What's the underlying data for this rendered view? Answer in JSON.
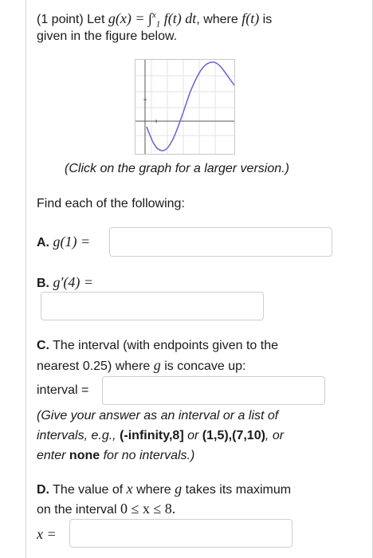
{
  "problem": {
    "points": "(1 point) Let",
    "def_lhs": "g(x) = ∫",
    "upper": "x",
    "lower": "1",
    "integrand": "f(t) dt",
    "where": ", where",
    "f_t": "f(t)",
    "is": "is",
    "line2": "given in the figure below."
  },
  "graph": {
    "click_hint": "(Click on the graph for a larger version.)"
  },
  "find_text": "Find each of the following:",
  "a": {
    "letter": "A.",
    "expr": "g(1) =",
    "value": ""
  },
  "b": {
    "letter": "B.",
    "expr": "g′(4) =",
    "value": ""
  },
  "c": {
    "letter": "C.",
    "line1": "The interval (with endpoints given to the",
    "line2_pre": "nearest 0.25) where",
    "line2_g": "g",
    "line2_post": "is concave up:",
    "interval_label": "interval =",
    "value": "",
    "help1": "(Give your answer as an interval or a list of",
    "help2_pre": "intervals, e.g.,",
    "help2_ex1": "(-infinity,8]",
    "help2_or": "or",
    "help2_ex2": "(1,5),(7,10)",
    "help2_post": ", or",
    "help3_pre": "enter",
    "help3_none": "none",
    "help3_post": "for no intervals.)"
  },
  "d": {
    "letter": "D.",
    "line1_pre": "The value of",
    "line1_x": "x",
    "line1_mid": "where",
    "line1_g": "g",
    "line1_post": "takes its maximum",
    "line2_pre": "on the interval",
    "line2_math": "0 ≤ x ≤ 8.",
    "x_label": "x =",
    "value": ""
  }
}
